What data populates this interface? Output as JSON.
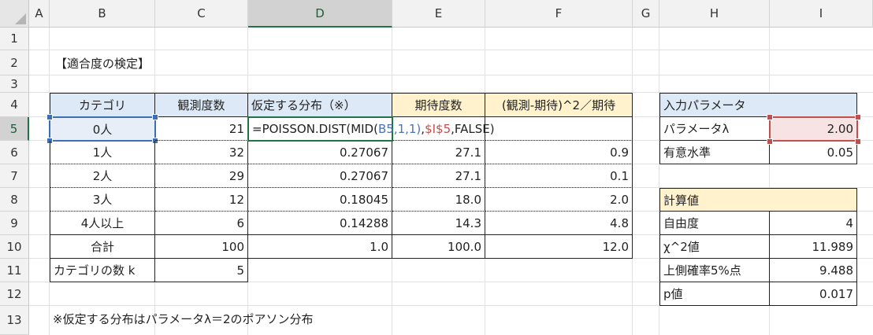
{
  "columns": [
    "A",
    "B",
    "C",
    "D",
    "E",
    "F",
    "G",
    "H",
    "I"
  ],
  "rows": [
    "1",
    "2",
    "3",
    "4",
    "5",
    "6",
    "7",
    "8",
    "9",
    "10",
    "11",
    "12",
    "13"
  ],
  "title": "【適合度の検定】",
  "main_table": {
    "headers": [
      "カテゴリ",
      "観測度数",
      "仮定する分布（※）",
      "期待度数",
      "(観測-期待)^2／期待"
    ],
    "rows": [
      {
        "cat": "0人",
        "obs": "21"
      },
      {
        "cat": "1人",
        "obs": "32",
        "dist": "0.27067",
        "exp": "27.1",
        "chi": "0.9"
      },
      {
        "cat": "2人",
        "obs": "29",
        "dist": "0.27067",
        "exp": "27.1",
        "chi": "0.1"
      },
      {
        "cat": "3人",
        "obs": "12",
        "dist": "0.18045",
        "exp": "18.0",
        "chi": "2.0"
      },
      {
        "cat": "4人以上",
        "obs": "6",
        "dist": "0.14288",
        "exp": "14.3",
        "chi": "4.8"
      }
    ],
    "total": {
      "label": "合計",
      "obs": "100",
      "dist": "1.0",
      "exp": "100.0",
      "chi": "12.0"
    },
    "k": {
      "label": "カテゴリの数 k",
      "value": "5"
    }
  },
  "formula": {
    "p1": "=POISSON.DIST(MID(",
    "ref1": "B5",
    "p2": ",1,1)",
    "p3": ",",
    "ref2": "$I$5",
    "p4": ",FALSE)"
  },
  "input_table": {
    "header": "入力パラメータ",
    "rows": [
      {
        "label": "パラメータλ",
        "value": "2.00"
      },
      {
        "label": "有意水準",
        "value": "0.05"
      }
    ]
  },
  "calc_table": {
    "header": "計算値",
    "rows": [
      {
        "label": "自由度",
        "value": "4"
      },
      {
        "label": "χ^2値",
        "value": "11.989"
      },
      {
        "label": "上側確率5%点",
        "value": "9.488"
      },
      {
        "label": "p値",
        "value": "0.017"
      }
    ]
  },
  "footnote": "※仮定する分布はパラメータλ＝2のポアソン分布",
  "colors": {
    "header_blue": "#dde9f6",
    "header_yellow": "#fff2cc",
    "input_pink": "#f8e3e4",
    "excel_green": "#217346",
    "ref_blue": "#4b72b8",
    "ref_red": "#c0504d"
  }
}
